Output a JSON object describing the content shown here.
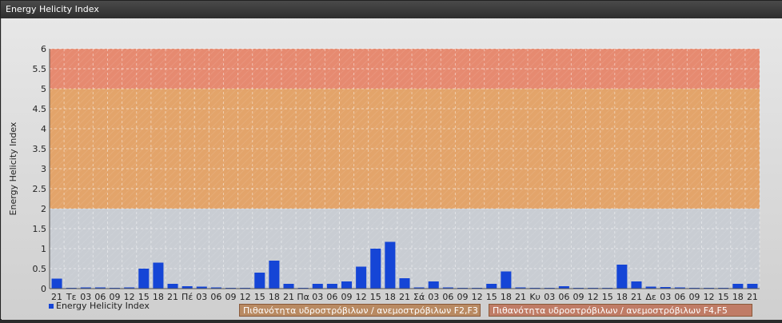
{
  "window": {
    "title": "Energy Helicity Index"
  },
  "legend": {
    "series_label": "Energy Helicity Index",
    "band1_label": "Πιθανότητα υδροστρόβιλων / ανεμοστρόβιλων F2,F3",
    "band2_label": "Πιθανότητα υδροστρόβιλων / ανεμοστρόβιλων F4,F5"
  },
  "colors": {
    "bar": "#1545d6",
    "band_low": "#c9cdd3",
    "band_mid": "#e3a46a",
    "band_high": "#e68a70",
    "band1_legend": "#b98a62",
    "band2_legend": "#c07c66"
  },
  "chart_data": {
    "type": "bar",
    "title": "",
    "ylabel": "Energy Helicity Index",
    "xlabel": "",
    "ylim": [
      0,
      6
    ],
    "yticks": [
      "0",
      "0.5",
      "1",
      "1.5",
      "2",
      "2.5",
      "3",
      "3.5",
      "4",
      "4.5",
      "5",
      "5.5",
      "6"
    ],
    "grid": true,
    "bands": [
      {
        "from": 0,
        "to": 2,
        "color": "#c9cdd3"
      },
      {
        "from": 2,
        "to": 5,
        "color": "#e3a46a"
      },
      {
        "from": 5,
        "to": 6,
        "color": "#e68a70"
      }
    ],
    "categories": [
      "21",
      "Τε",
      "03",
      "06",
      "09",
      "12",
      "15",
      "18",
      "21",
      "Πέ",
      "03",
      "06",
      "09",
      "12",
      "15",
      "18",
      "21",
      "Πα",
      "03",
      "06",
      "09",
      "12",
      "15",
      "18",
      "21",
      "Σά",
      "03",
      "06",
      "09",
      "12",
      "15",
      "18",
      "21",
      "Κυ",
      "03",
      "06",
      "09",
      "12",
      "15",
      "18",
      "21",
      "Δε",
      "03",
      "06",
      "09",
      "12",
      "15",
      "18",
      "21"
    ],
    "series": [
      {
        "name": "Energy Helicity Index",
        "values": [
          0.25,
          0.02,
          0.03,
          0.03,
          0.02,
          0.03,
          0.5,
          0.65,
          0.12,
          0.06,
          0.05,
          0.03,
          0.02,
          0.02,
          0.4,
          0.7,
          0.12,
          0.02,
          0.12,
          0.12,
          0.18,
          0.55,
          1.0,
          1.17,
          0.26,
          0.03,
          0.18,
          0.03,
          0.02,
          0.02,
          0.12,
          0.43,
          0.03,
          0.02,
          0.02,
          0.06,
          0.02,
          0.02,
          0.02,
          0.6,
          0.18,
          0.05,
          0.04,
          0.03,
          0.02,
          0.02,
          0.02,
          0.12,
          0.12
        ]
      }
    ]
  }
}
